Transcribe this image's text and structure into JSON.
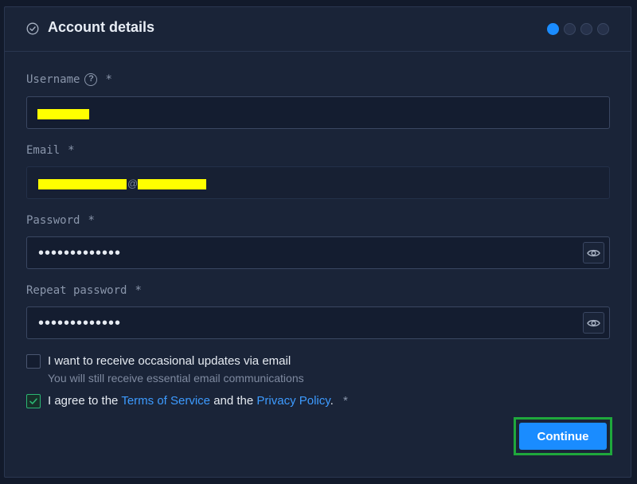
{
  "header": {
    "title": "Account details",
    "step_count": 4,
    "active_step": 1
  },
  "form": {
    "username": {
      "label": "Username",
      "required_mark": "*",
      "help_icon": "question-circle-icon"
    },
    "email": {
      "label": "Email",
      "required_mark": "*",
      "at_sign": "@"
    },
    "password": {
      "label": "Password",
      "required_mark": "*",
      "value_masked": "•••••••••••••"
    },
    "repeat_password": {
      "label": "Repeat password",
      "required_mark": "*",
      "value_masked": "•••••••••••••"
    }
  },
  "updates_checkbox": {
    "checked": false,
    "label": "I want to receive occasional updates via email",
    "sublabel": "You will still receive essential email communications"
  },
  "agree_checkbox": {
    "checked": true,
    "prefix": "I agree to the",
    "terms_link": "Terms of Service",
    "middle": "and the",
    "privacy_link": "Privacy Policy",
    "suffix": ".",
    "required_mark": "*"
  },
  "continue_label": "Continue",
  "colors": {
    "accent": "#1a8cff",
    "link": "#3d9bff",
    "checked_green": "#2bb673",
    "highlight_outline": "#1fa83c",
    "redaction": "#ffff00"
  }
}
